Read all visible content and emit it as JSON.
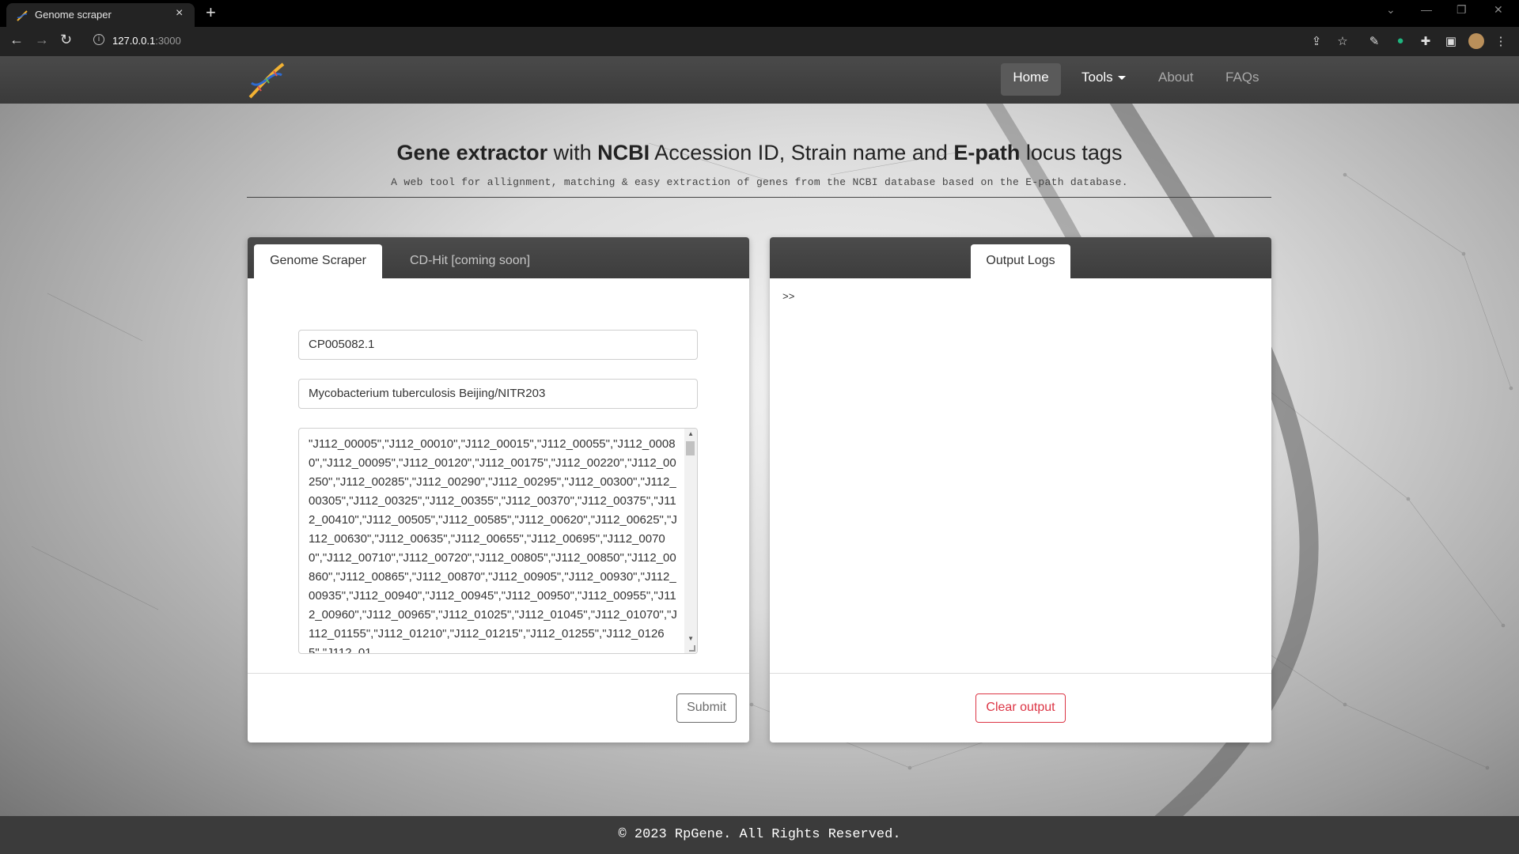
{
  "browser": {
    "tab_title": "Genome scraper",
    "tab_close": "×",
    "new_tab": "+",
    "url_host": "127.0.0.1",
    "url_port": ":3000",
    "window_controls": [
      "⌄",
      "—",
      "❐",
      "✕"
    ],
    "nav_icons": [
      "back-icon",
      "forward-icon",
      "reload-icon"
    ],
    "toolbar_icons": [
      "share-icon",
      "star-icon",
      "extension-eyedropper-icon",
      "extension-grammarly-icon",
      "puzzle-icon",
      "sidepanel-icon",
      "profile-avatar",
      "kebab-menu-icon"
    ]
  },
  "nav": {
    "home": "Home",
    "tools": "Tools",
    "about": "About",
    "faqs": "FAQs"
  },
  "hero": {
    "title_parts": [
      "Gene extractor",
      " with ",
      "NCBI",
      " Accession ID, Strain name and ",
      "E-path",
      " locus tags"
    ],
    "subtitle": "A web tool for allignment, matching & easy extraction of genes from the NCBI database based on the E-path database."
  },
  "left_card": {
    "tabs": [
      "Genome Scraper",
      "CD-Hit [coming soon]"
    ],
    "accession_value": "CP005082.1",
    "strain_value": "Mycobacterium tuberculosis Beijing/NITR203",
    "locus_tags_value": "\"J112_00005\",\"J112_00010\",\"J112_00015\",\"J112_00055\",\"J112_00080\",\"J112_00095\",\"J112_00120\",\"J112_00175\",\"J112_00220\",\"J112_00250\",\"J112_00285\",\"J112_00290\",\"J112_00295\",\"J112_00300\",\"J112_00305\",\"J112_00325\",\"J112_00355\",\"J112_00370\",\"J112_00375\",\"J112_00410\",\"J112_00505\",\"J112_00585\",\"J112_00620\",\"J112_00625\",\"J112_00630\",\"J112_00635\",\"J112_00655\",\"J112_00695\",\"J112_00700\",\"J112_00710\",\"J112_00720\",\"J112_00805\",\"J112_00850\",\"J112_00860\",\"J112_00865\",\"J112_00870\",\"J112_00905\",\"J112_00930\",\"J112_00935\",\"J112_00940\",\"J112_00945\",\"J112_00950\",\"J112_00955\",\"J112_00960\",\"J112_00965\",\"J112_01025\",\"J112_01045\",\"J112_01070\",\"J112_01155\",\"J112_01210\",\"J112_01215\",\"J112_01255\",\"J112_01265\",\"J112_01",
    "submit_label": "Submit"
  },
  "right_card": {
    "tab": "Output Logs",
    "log_text": ">>",
    "clear_label": "Clear output"
  },
  "footer": {
    "text": "© 2023 RpGene. All Rights Reserved."
  },
  "colors": {
    "navbar": "#3f3f3f",
    "danger": "#dc3545",
    "secondary": "#6c6c6c"
  }
}
